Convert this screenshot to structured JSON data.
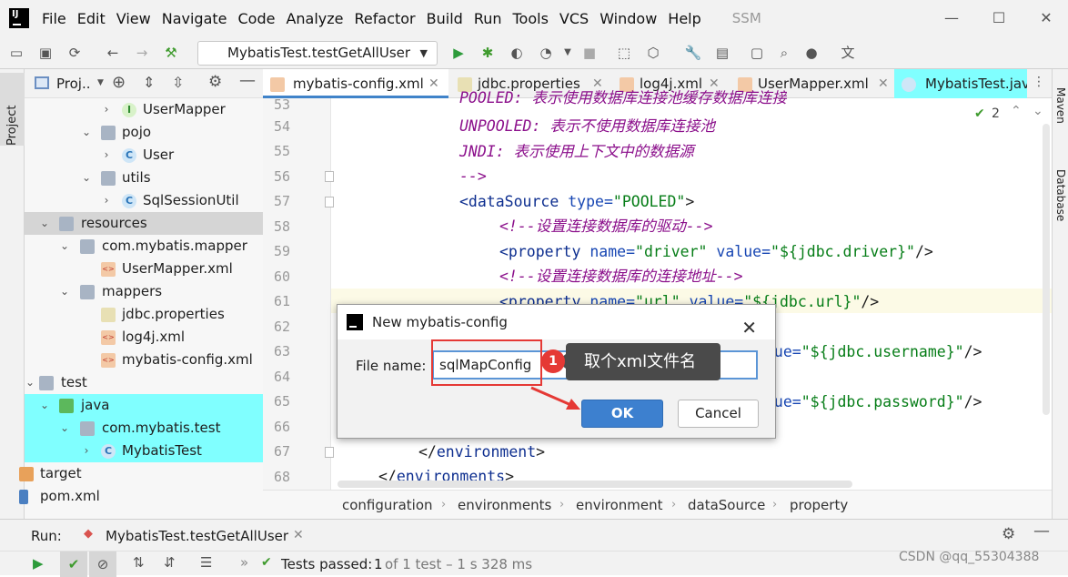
{
  "menubar": {
    "items": [
      "File",
      "Edit",
      "View",
      "Navigate",
      "Code",
      "Analyze",
      "Refactor",
      "Build",
      "Run",
      "Tools",
      "VCS",
      "Window",
      "Help"
    ],
    "project_name": "SSM"
  },
  "toolbar": {
    "run_config": "MybatisTest.testGetAllUser"
  },
  "left_strip": {
    "project_tab": "Project"
  },
  "right_strip": {
    "maven": "Maven",
    "database": "Database"
  },
  "project_panel": {
    "title": "Proj..",
    "tree": [
      {
        "label": "UserMapper",
        "icon": "interface-icon"
      },
      {
        "label": "pojo",
        "icon": "package-icon"
      },
      {
        "label": "User",
        "icon": "class-icon"
      },
      {
        "label": "utils",
        "icon": "package-icon"
      },
      {
        "label": "SqlSessionUtil",
        "icon": "class-icon"
      },
      {
        "label": "resources",
        "icon": "resources-folder-icon"
      },
      {
        "label": "com.mybatis.mapper",
        "icon": "folder-icon"
      },
      {
        "label": "UserMapper.xml",
        "icon": "xml-file-icon"
      },
      {
        "label": "mappers",
        "icon": "folder-icon"
      },
      {
        "label": "jdbc.properties",
        "icon": "properties-file-icon"
      },
      {
        "label": "log4j.xml",
        "icon": "xml-file-icon"
      },
      {
        "label": "mybatis-config.xml",
        "icon": "xml-file-icon"
      },
      {
        "label": "test",
        "icon": "folder-icon"
      },
      {
        "label": "java",
        "icon": "test-source-folder-icon"
      },
      {
        "label": "com.mybatis.test",
        "icon": "package-icon"
      },
      {
        "label": "MybatisTest",
        "icon": "test-class-icon"
      },
      {
        "label": "target",
        "icon": "folder-icon"
      },
      {
        "label": "pom.xml",
        "icon": "maven-file-icon"
      }
    ]
  },
  "editor": {
    "tabs": [
      "mybatis-config.xml",
      "jdbc.properties",
      "log4j.xml",
      "UserMapper.xml",
      "MybatisTest.jav"
    ],
    "inspection_count": "2",
    "line_numbers": [
      "53",
      "54",
      "55",
      "56",
      "57",
      "58",
      "59",
      "60",
      "61",
      "62",
      "63",
      "64",
      "65",
      "66",
      "67",
      "68"
    ],
    "lines": {
      "l53": "POOLED: 表示使用数据库连接池缓存数据库连接",
      "l54": "UNPOOLED: 表示不使用数据库连接池",
      "l55": "JNDI: 表示使用上下文中的数据源",
      "l56": "-->",
      "l57_tag": "<dataSource",
      "l57_attr": " type=",
      "l57_val": "\"POOLED\"",
      "l57_end": ">",
      "l58": "<!--设置连接数据库的驱动-->",
      "l59_tag": "<property",
      "l59_attr1": " name=",
      "l59_val1": "\"driver\"",
      "l59_attr2": " value=",
      "l59_val2": "\"${jdbc.driver}\"",
      "l59_end": "/>",
      "l60": "<!--设置连接数据库的连接地址-->",
      "l61_tag": "<property",
      "l61_attr1": " name=",
      "l61_val1": "\"url\"",
      "l61_attr2": " value=",
      "l61_val2": "\"${jdbc.url}\"",
      "l61_end": "/>",
      "l63_attr": "lue=",
      "l63_val": "\"${jdbc.username}\"",
      "l63_end": "/>",
      "l65_attr": "lue=",
      "l65_val": "\"${jdbc.password}\"",
      "l65_end": "/>",
      "l67_open": "</",
      "l67_tag": "environment",
      "l67_close": ">",
      "l68_open": "</",
      "l68_tag": "environments",
      "l68_close": ">"
    },
    "breadcrumbs": [
      "configuration",
      "environments",
      "environment",
      "dataSource",
      "property"
    ]
  },
  "dialog": {
    "title": "New mybatis-config",
    "file_name_label": "File name:",
    "file_name_value": "sqlMapConfig",
    "ok_label": "OK",
    "cancel_label": "Cancel"
  },
  "annotation": {
    "badge": "1",
    "note": "取个xml文件名"
  },
  "run_panel": {
    "label": "Run:",
    "tab": "MybatisTest.testGetAllUser",
    "status_prefix": "Tests passed:",
    "status_count": "1",
    "status_detail": "of 1 test – 1 s 328 ms"
  },
  "watermark": "CSDN @qq_55304388",
  "colors": {
    "accent": "#3d80cf",
    "annotation_red": "#e53935",
    "test_highlight": "#80ffff",
    "selected_row": "#d5d5d5"
  }
}
